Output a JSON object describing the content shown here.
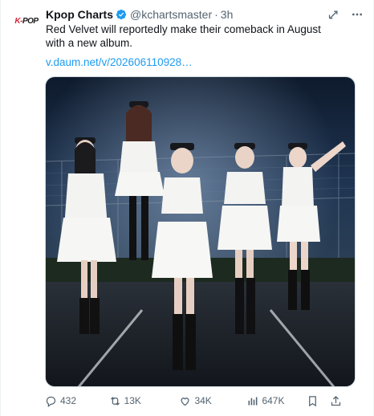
{
  "author": {
    "display_name": "Kpop Charts",
    "handle": "@kchartsmaster",
    "separator": "·",
    "time": "3h",
    "avatar_text_k": "K-",
    "avatar_text_pop": "POP"
  },
  "tweet": {
    "text": "Red Velvet will reportedly make their comeback in August with a new album.",
    "link": "v.daum.net/v/202606110928…"
  },
  "actions": {
    "replies": "432",
    "reposts": "13K",
    "likes": "34K",
    "views": "647K"
  },
  "colors": {
    "accent": "#1d9bf0",
    "verified": "#1d9bf0",
    "muted": "#536471"
  },
  "icons": [
    "verified-badge-icon",
    "grok-icon",
    "more-icon",
    "reply-icon",
    "repost-icon",
    "like-icon",
    "views-icon",
    "bookmark-icon",
    "share-icon"
  ]
}
